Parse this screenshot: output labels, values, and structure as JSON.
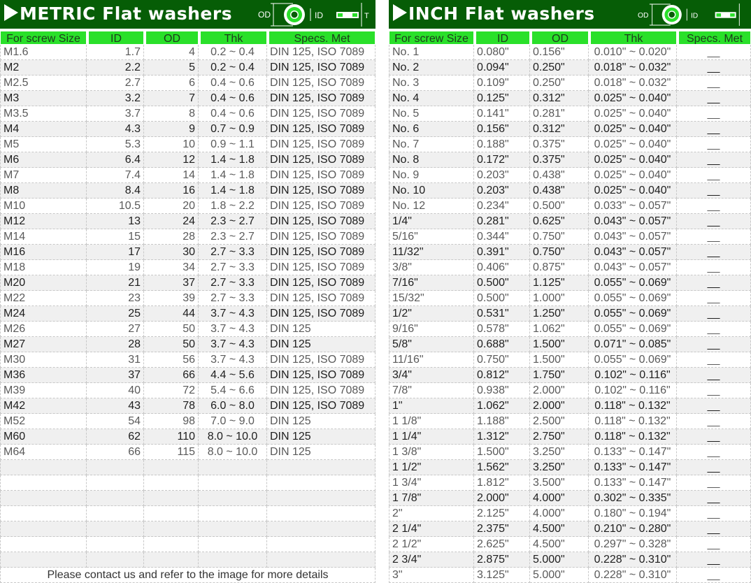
{
  "metric": {
    "title": "METRIC  Flat washers",
    "diagram": {
      "od": "OD",
      "id": "ID",
      "t": "T"
    },
    "headers": [
      "For screw Size",
      "ID",
      "OD",
      "Thk",
      "Specs. Met"
    ],
    "rows": [
      [
        "M1.6",
        "1.7",
        "4",
        "0.2 ~ 0.4",
        "DIN 125, ISO 7089"
      ],
      [
        "M2",
        "2.2",
        "5",
        "0.2 ~ 0.4",
        "DIN 125, ISO 7089"
      ],
      [
        "M2.5",
        "2.7",
        "6",
        "0.4 ~ 0.6",
        "DIN 125, ISO 7089"
      ],
      [
        "M3",
        "3.2",
        "7",
        "0.4 ~ 0.6",
        "DIN 125, ISO 7089"
      ],
      [
        "M3.5",
        "3.7",
        "8",
        "0.4 ~ 0.6",
        "DIN 125, ISO 7089"
      ],
      [
        "M4",
        "4.3",
        "9",
        "0.7 ~ 0.9",
        "DIN 125, ISO 7089"
      ],
      [
        "M5",
        "5.3",
        "10",
        "0.9 ~ 1.1",
        "DIN 125, ISO 7089"
      ],
      [
        "M6",
        "6.4",
        "12",
        "1.4 ~ 1.8",
        "DIN 125, ISO 7089"
      ],
      [
        "M7",
        "7.4",
        "14",
        "1.4 ~ 1.8",
        "DIN 125, ISO 7089"
      ],
      [
        "M8",
        "8.4",
        "16",
        "1.4 ~ 1.8",
        "DIN 125, ISO 7089"
      ],
      [
        "M10",
        "10.5",
        "20",
        "1.8 ~ 2.2",
        "DIN 125, ISO 7089"
      ],
      [
        "M12",
        "13",
        "24",
        "2.3 ~ 2.7",
        "DIN 125, ISO 7089"
      ],
      [
        "M14",
        "15",
        "28",
        "2.3 ~ 2.7",
        "DIN 125, ISO 7089"
      ],
      [
        "M16",
        "17",
        "30",
        "2.7 ~ 3.3",
        "DIN 125, ISO 7089"
      ],
      [
        "M18",
        "19",
        "34",
        "2.7 ~ 3.3",
        "DIN 125, ISO 7089"
      ],
      [
        "M20",
        "21",
        "37",
        "2.7 ~ 3.3",
        "DIN 125, ISO 7089"
      ],
      [
        "M22",
        "23",
        "39",
        "2.7 ~ 3.3",
        "DIN 125, ISO 7089"
      ],
      [
        "M24",
        "25",
        "44",
        "3.7 ~ 4.3",
        "DIN 125, ISO 7089"
      ],
      [
        "M26",
        "27",
        "50",
        "3.7 ~ 4.3",
        "DIN 125"
      ],
      [
        "M27",
        "28",
        "50",
        "3.7 ~ 4.3",
        "DIN 125"
      ],
      [
        "M30",
        "31",
        "56",
        "3.7 ~ 4.3",
        "DIN 125, ISO 7089"
      ],
      [
        "M36",
        "37",
        "66",
        "4.4 ~ 5.6",
        "DIN 125, ISO 7089"
      ],
      [
        "M39",
        "40",
        "72",
        "5.4 ~ 6.6",
        "DIN 125, ISO 7089"
      ],
      [
        "M42",
        "43",
        "78",
        "6.0 ~ 8.0",
        "DIN 125, ISO 7089"
      ],
      [
        "M52",
        "54",
        "98",
        "7.0 ~ 9.0",
        "DIN 125"
      ],
      [
        "M60",
        "62",
        "110",
        "8.0 ~ 10.0",
        "DIN 125"
      ],
      [
        "M64",
        "66",
        "115",
        "8.0 ~ 10.0",
        "DIN 125"
      ]
    ],
    "footer": "Please contact us and refer to the image for more details"
  },
  "inch": {
    "title": "INCH  Flat washers",
    "diagram": {
      "od": "OD",
      "id": "ID",
      "t": "T"
    },
    "headers": [
      "For screw Size",
      "ID",
      "OD",
      "Thk",
      "Specs. Met"
    ],
    "rows": [
      [
        "No. 1",
        "0.080\"",
        "0.156\"",
        "0.010\" ~ 0.020\"",
        "__"
      ],
      [
        "No. 2",
        "0.094\"",
        "0.250\"",
        "0.018\" ~ 0.032\"",
        "__"
      ],
      [
        "No. 3",
        "0.109\"",
        "0.250\"",
        "0.018\" ~ 0.032\"",
        "__"
      ],
      [
        "No. 4",
        "0.125\"",
        "0.312\"",
        "0.025\" ~ 0.040\"",
        "__"
      ],
      [
        "No. 5",
        "0.141\"",
        "0.281\"",
        "0.025\" ~ 0.040\"",
        "__"
      ],
      [
        "No. 6",
        "0.156\"",
        "0.312\"",
        "0.025\" ~ 0.040\"",
        "__"
      ],
      [
        "No. 7",
        "0.188\"",
        "0.375\"",
        "0.025\" ~ 0.040\"",
        "__"
      ],
      [
        "No. 8",
        "0.172\"",
        "0.375\"",
        "0.025\" ~ 0.040\"",
        "__"
      ],
      [
        "No. 9",
        "0.203\"",
        "0.438\"",
        "0.025\" ~ 0.040\"",
        "__"
      ],
      [
        "No. 10",
        "0.203\"",
        "0.438\"",
        "0.025\" ~ 0.040\"",
        "__"
      ],
      [
        "No. 12",
        "0.234\"",
        "0.500\"",
        "0.033\" ~ 0.057\"",
        "__"
      ],
      [
        "1/4\"",
        "0.281\"",
        "0.625\"",
        "0.043\" ~ 0.057\"",
        "__"
      ],
      [
        "5/16\"",
        "0.344\"",
        "0.750\"",
        "0.043\" ~ 0.057\"",
        "__"
      ],
      [
        "11/32\"",
        "0.391\"",
        "0.750\"",
        "0.043\" ~ 0.057\"",
        "__"
      ],
      [
        "3/8\"",
        "0.406\"",
        "0.875\"",
        "0.043\" ~ 0.057\"",
        "__"
      ],
      [
        "7/16\"",
        "0.500\"",
        "1.125\"",
        "0.055\" ~ 0.069\"",
        "__"
      ],
      [
        "15/32\"",
        "0.500\"",
        "1.000\"",
        "0.055\" ~ 0.069\"",
        "__"
      ],
      [
        "1/2\"",
        "0.531\"",
        "1.250\"",
        "0.055\" ~ 0.069\"",
        "__"
      ],
      [
        "9/16\"",
        "0.578\"",
        "1.062\"",
        "0.055\" ~ 0.069\"",
        "__"
      ],
      [
        "5/8\"",
        "0.688\"",
        "1.500\"",
        "0.071\" ~ 0.085\"",
        "__"
      ],
      [
        "11/16\"",
        "0.750\"",
        "1.500\"",
        "0.055\" ~ 0.069\"",
        "__"
      ],
      [
        "3/4\"",
        "0.812\"",
        "1.750\"",
        "0.102\" ~ 0.116\"",
        "__"
      ],
      [
        "7/8\"",
        "0.938\"",
        "2.000\"",
        "0.102\" ~ 0.116\"",
        "__"
      ],
      [
        "1\"",
        "1.062\"",
        "2.000\"",
        "0.118\" ~ 0.132\"",
        "__"
      ],
      [
        "1 1/8\"",
        "1.188\"",
        "2.500\"",
        "0.118\" ~ 0.132\"",
        "__"
      ],
      [
        "1 1/4\"",
        "1.312\"",
        "2.750\"",
        "0.118\" ~ 0.132\"",
        "__"
      ],
      [
        "1 3/8\"",
        "1.500\"",
        "3.250\"",
        "0.133\" ~ 0.147\"",
        "__"
      ],
      [
        "1 1/2\"",
        "1.562\"",
        "3.250\"",
        "0.133\" ~ 0.147\"",
        "__"
      ],
      [
        "1 3/4\"",
        "1.812\"",
        "3.500\"",
        "0.133\" ~ 0.147\"",
        "__"
      ],
      [
        "1 7/8\"",
        "2.000\"",
        "4.000\"",
        "0.302\" ~ 0.335\"",
        "__"
      ],
      [
        "2\"",
        "2.125\"",
        "4.000\"",
        "0.180\" ~ 0.194\"",
        "__"
      ],
      [
        "2 1/4\"",
        "2.375\"",
        "4.500\"",
        "0.210\" ~ 0.280\"",
        "__"
      ],
      [
        "2 1/2\"",
        "2.625\"",
        "4.500\"",
        "0.297\" ~ 0.328\"",
        "__"
      ],
      [
        "2 3/4\"",
        "2.875\"",
        "5.000\"",
        "0.228\" ~ 0.310\"",
        "__"
      ],
      [
        "3\"",
        "3.125\"",
        "5.000\"",
        "0.228\" ~ 0.310\"",
        "__"
      ]
    ]
  }
}
